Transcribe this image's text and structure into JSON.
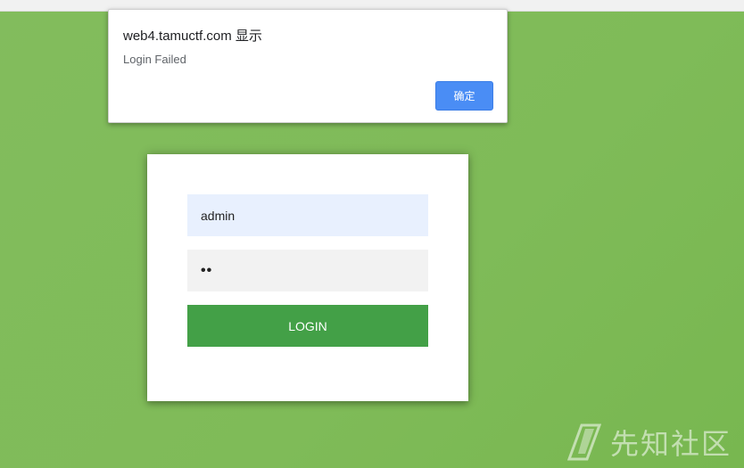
{
  "browser": {
    "alert": {
      "title": "web4.tamuctf.com 显示",
      "message": "Login Failed",
      "ok_label": "确定",
      "ok_color": "#4a8df5"
    }
  },
  "login": {
    "username_value": "admin",
    "password_mask": "••",
    "submit_label": "LOGIN",
    "button_color": "#43a047",
    "background_color": "#7fbb58"
  },
  "watermark": {
    "text": "先知社区",
    "icon": "xianzhi-logo-icon"
  }
}
